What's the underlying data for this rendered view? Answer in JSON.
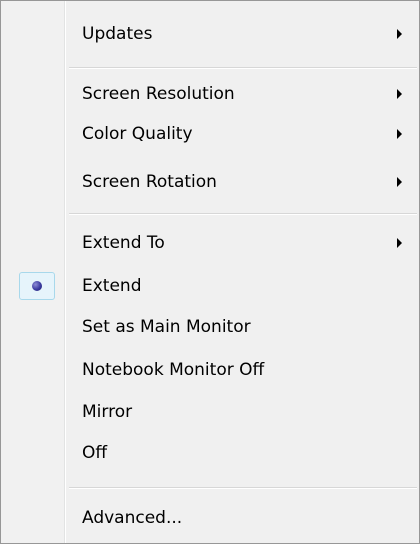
{
  "menu": {
    "items": [
      {
        "label": "Updates",
        "submenu": true
      },
      {
        "label": "Screen Resolution",
        "submenu": true
      },
      {
        "label": "Color Quality",
        "submenu": true
      },
      {
        "label": "Screen Rotation",
        "submenu": true
      },
      {
        "label": "Extend To",
        "submenu": true
      },
      {
        "label": "Extend",
        "submenu": false,
        "selected": true
      },
      {
        "label": "Set as Main Monitor",
        "submenu": false
      },
      {
        "label": "Notebook Monitor Off",
        "submenu": false
      },
      {
        "label": "Mirror",
        "submenu": false
      },
      {
        "label": "Off",
        "submenu": false
      },
      {
        "label": "Advanced...",
        "submenu": false
      }
    ]
  },
  "colors": {
    "radio_dot": "#3b3ba0",
    "check_highlight": "#e6f4fb"
  }
}
